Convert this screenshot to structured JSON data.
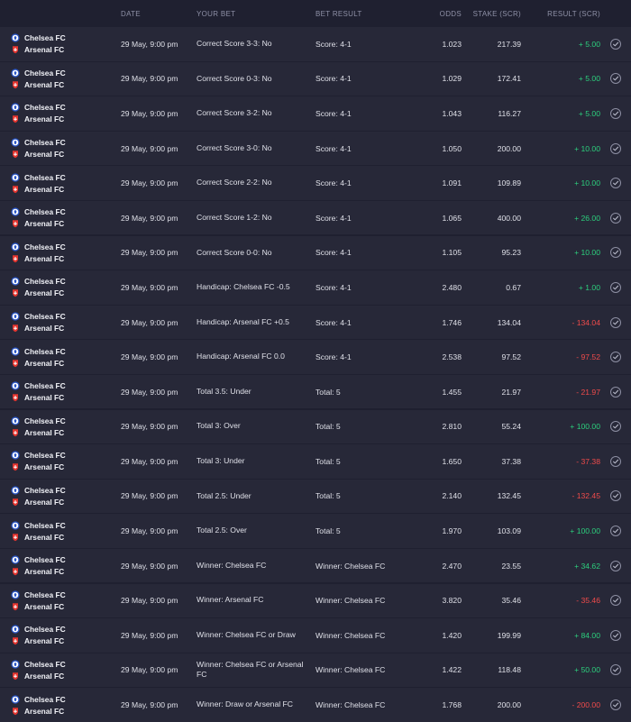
{
  "header": {
    "date": "DATE",
    "your_bet": "YOUR BET",
    "bet_result": "BET RESULT",
    "odds": "ODDS",
    "stake": "STAKE (SCR)",
    "result": "RESULT (SCR)"
  },
  "teams": {
    "home": "Chelsea FC",
    "away": "Arsenal FC"
  },
  "rows": [
    {
      "date": "29 May, 9:00 pm",
      "bet": "Correct Score 3-3: No",
      "bet_result": "Score: 4-1",
      "odds": "1.023",
      "stake": "217.39",
      "result": "+ 5.00",
      "status": "positive"
    },
    {
      "date": "29 May, 9:00 pm",
      "bet": "Correct Score 0-3: No",
      "bet_result": "Score: 4-1",
      "odds": "1.029",
      "stake": "172.41",
      "result": "+ 5.00",
      "status": "positive"
    },
    {
      "date": "29 May, 9:00 pm",
      "bet": "Correct Score 3-2: No",
      "bet_result": "Score: 4-1",
      "odds": "1.043",
      "stake": "116.27",
      "result": "+ 5.00",
      "status": "positive"
    },
    {
      "date": "29 May, 9:00 pm",
      "bet": "Correct Score 3-0: No",
      "bet_result": "Score: 4-1",
      "odds": "1.050",
      "stake": "200.00",
      "result": "+ 10.00",
      "status": "positive"
    },
    {
      "date": "29 May, 9:00 pm",
      "bet": "Correct Score 2-2: No",
      "bet_result": "Score: 4-1",
      "odds": "1.091",
      "stake": "109.89",
      "result": "+ 10.00",
      "status": "positive"
    },
    {
      "date": "29 May, 9:00 pm",
      "bet": "Correct Score 1-2: No",
      "bet_result": "Score: 4-1",
      "odds": "1.065",
      "stake": "400.00",
      "result": "+ 26.00",
      "status": "positive"
    },
    {
      "date": "29 May, 9:00 pm",
      "bet": "Correct Score 0-0: No",
      "bet_result": "Score: 4-1",
      "odds": "1.105",
      "stake": "95.23",
      "result": "+ 10.00",
      "status": "positive"
    },
    {
      "date": "29 May, 9:00 pm",
      "bet": "Handicap: Chelsea FC -0.5",
      "bet_result": "Score: 4-1",
      "odds": "2.480",
      "stake": "0.67",
      "result": "+ 1.00",
      "status": "positive"
    },
    {
      "date": "29 May, 9:00 pm",
      "bet": "Handicap: Arsenal FC +0.5",
      "bet_result": "Score: 4-1",
      "odds": "1.746",
      "stake": "134.04",
      "result": "- 134.04",
      "status": "negative"
    },
    {
      "date": "29 May, 9:00 pm",
      "bet": "Handicap: Arsenal FC 0.0",
      "bet_result": "Score: 4-1",
      "odds": "2.538",
      "stake": "97.52",
      "result": "- 97.52",
      "status": "negative"
    },
    {
      "date": "29 May, 9:00 pm",
      "bet": "Total 3.5: Under",
      "bet_result": "Total: 5",
      "odds": "1.455",
      "stake": "21.97",
      "result": "- 21.97",
      "status": "negative"
    },
    {
      "date": "29 May, 9:00 pm",
      "bet": "Total 3: Over",
      "bet_result": "Total: 5",
      "odds": "2.810",
      "stake": "55.24",
      "result": "+ 100.00",
      "status": "positive"
    },
    {
      "date": "29 May, 9:00 pm",
      "bet": "Total 3: Under",
      "bet_result": "Total: 5",
      "odds": "1.650",
      "stake": "37.38",
      "result": "- 37.38",
      "status": "negative"
    },
    {
      "date": "29 May, 9:00 pm",
      "bet": "Total 2.5: Under",
      "bet_result": "Total: 5",
      "odds": "2.140",
      "stake": "132.45",
      "result": "- 132.45",
      "status": "negative"
    },
    {
      "date": "29 May, 9:00 pm",
      "bet": "Total 2.5: Over",
      "bet_result": "Total: 5",
      "odds": "1.970",
      "stake": "103.09",
      "result": "+ 100.00",
      "status": "positive"
    },
    {
      "date": "29 May, 9:00 pm",
      "bet": "Winner: Chelsea FC",
      "bet_result": "Winner: Chelsea FC",
      "odds": "2.470",
      "stake": "23.55",
      "result": "+ 34.62",
      "status": "positive"
    },
    {
      "date": "29 May, 9:00 pm",
      "bet": "Winner: Arsenal FC",
      "bet_result": "Winner: Chelsea FC",
      "odds": "3.820",
      "stake": "35.46",
      "result": "- 35.46",
      "status": "negative"
    },
    {
      "date": "29 May, 9:00 pm",
      "bet": "Winner: Chelsea FC or Draw",
      "bet_result": "Winner: Chelsea FC",
      "odds": "1.420",
      "stake": "199.99",
      "result": "+ 84.00",
      "status": "positive"
    },
    {
      "date": "29 May, 9:00 pm",
      "bet": "Winner: Chelsea FC or Arsenal FC",
      "bet_result": "Winner: Chelsea FC",
      "odds": "1.422",
      "stake": "118.48",
      "result": "+ 50.00",
      "status": "positive"
    },
    {
      "date": "29 May, 9:00 pm",
      "bet": "Winner: Draw or Arsenal FC",
      "bet_result": "Winner: Chelsea FC",
      "odds": "1.768",
      "stake": "200.00",
      "result": "- 200.00",
      "status": "negative"
    }
  ],
  "icons": {
    "home_logo": "chelsea-logo-icon",
    "away_logo": "arsenal-logo-icon",
    "status": "check-circle-icon"
  },
  "colors": {
    "positive": "#2ccf7d",
    "negative": "#f04b4b",
    "background": "#1f2030",
    "row_background": "#272838",
    "header_text": "#8e90a6"
  }
}
